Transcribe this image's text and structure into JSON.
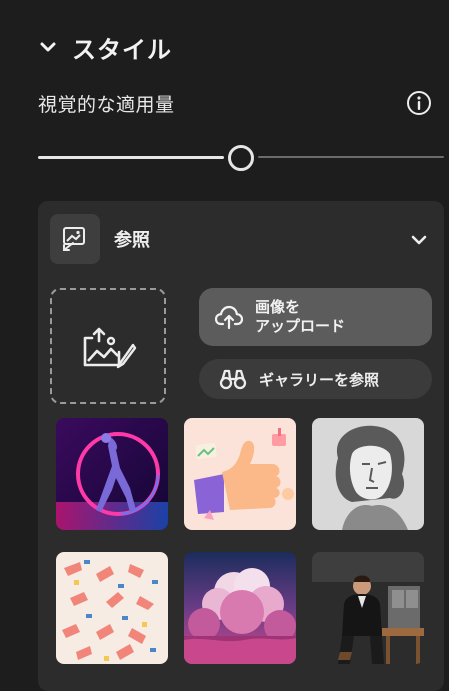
{
  "section": {
    "title": "スタイル",
    "icon": "chevron-down-icon"
  },
  "strength": {
    "label": "視覚的な適用量",
    "info_icon": "info-icon",
    "value_fraction": 0.5
  },
  "reference": {
    "title": "参照",
    "icon": "image-reference-icon",
    "collapse_icon": "chevron-up-icon",
    "dropzone_icon": "image-upload-icon",
    "upload_button": "画像を\nアップロード",
    "upload_icon": "cloud-upload-icon",
    "gallery_button": "ギャラリーを参照",
    "gallery_icon": "binoculars-icon"
  },
  "gallery": {
    "items": [
      "neon-ring-dancer",
      "3d-thumbs-up-hand",
      "renaissance-sketch-portrait",
      "hand-gesture-pattern",
      "pink-cloudscape",
      "man-seated-loft"
    ]
  },
  "colors": {
    "background": "#1d1d1d",
    "panel": "#2c2c2c",
    "upload_button": "#5c5c5c",
    "gallery_button": "#3b3b3b",
    "text": "#ededed"
  }
}
